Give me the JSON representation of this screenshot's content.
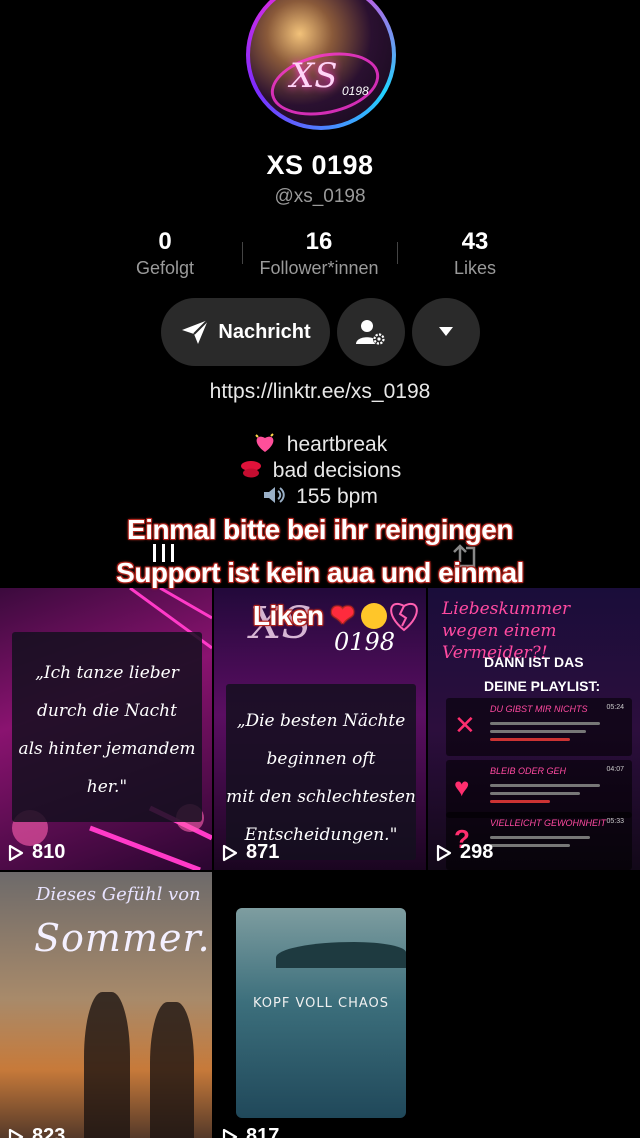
{
  "profile": {
    "avatar_text": "XS",
    "avatar_num": "0198",
    "name": "XS 0198",
    "handle": "@xs_0198"
  },
  "stats": [
    {
      "value": "0",
      "label": "Gefolgt"
    },
    {
      "value": "16",
      "label": "Follower*innen"
    },
    {
      "value": "43",
      "label": "Likes"
    }
  ],
  "actions": {
    "message_label": "Nachricht",
    "icons": [
      "send-icon",
      "add-friend-settings-icon",
      "triangle-down-icon"
    ]
  },
  "link": "https://linktr.ee/xs_0198",
  "bio": [
    {
      "emoji": "sparkling-heart",
      "text": "heartbreak"
    },
    {
      "emoji": "kiss-mark",
      "text": "bad decisions"
    },
    {
      "emoji": "speaker",
      "text": "155 bpm"
    }
  ],
  "overlay_caption": {
    "line1": "Einmal bitte bei ihr reingingen",
    "line2": "Support ist kein aua und einmal",
    "line3": "Liken"
  },
  "videos": [
    {
      "views": "810",
      "quote": [
        "„Ich tanze lieber",
        "durch die Nacht",
        "als hinter jemandem",
        "her.\""
      ]
    },
    {
      "views": "871",
      "brand": "XS",
      "brand_num": "0198",
      "quote": [
        "„Die besten Nächte",
        "beginnen oft",
        "mit den schlechtesten",
        "Entscheidungen.\""
      ]
    },
    {
      "views": "298",
      "title": "Liebeskummer wegen einem Vermeider?!",
      "subtitle": [
        "DANN IST DAS",
        "DEINE PLAYLIST:"
      ],
      "tracks": [
        {
          "title": "DU GIBST MIR NICHTS",
          "time": "05:24"
        },
        {
          "title": "BLEIB ODER GEH",
          "time": "04:07"
        },
        {
          "title": "VIELLEICHT GEWOHNHEIT",
          "time": "05:33"
        }
      ]
    },
    {
      "views": "823",
      "title": "Dieses Gefühl von",
      "big": "Sommer..."
    },
    {
      "views": "817",
      "card_text": "KOPF VOLL CHAOS"
    }
  ],
  "colors": {
    "background": "#000000",
    "button_bg": "#2a2a2a",
    "muted_text": "#9a9a9a",
    "caption_outline": "#a31515",
    "neon_pink": "#ff2bd6"
  }
}
